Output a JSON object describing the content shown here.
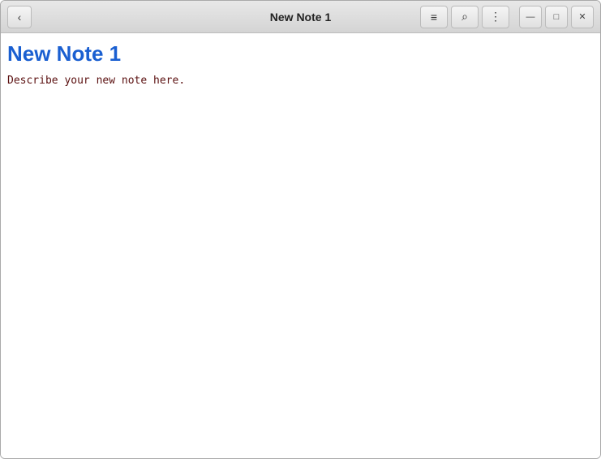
{
  "titlebar": {
    "title": "New Note 1",
    "back_label": "‹",
    "icon_note": "≡",
    "icon_search": "⌕",
    "icon_menu": "⋮",
    "icon_minimize": "—",
    "icon_maximize": "□",
    "icon_close": "✕"
  },
  "note": {
    "title": "New Note 1",
    "body": "Describe your new note here."
  }
}
